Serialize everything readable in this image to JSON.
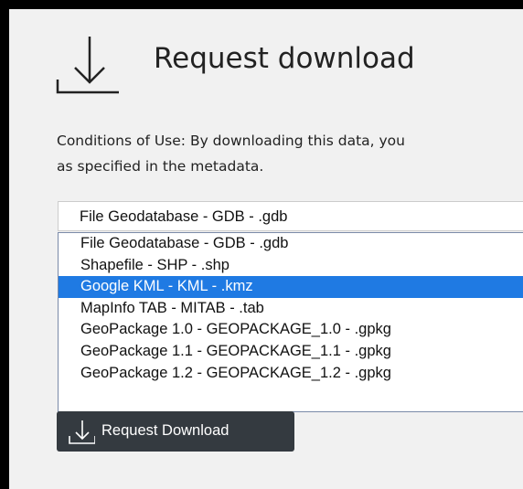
{
  "header": {
    "title": "Request download",
    "icon": "download-icon"
  },
  "conditions": {
    "text": "Conditions of Use: By downloading this data, you\nas specified in the metadata."
  },
  "format_select": {
    "selected": "File Geodatabase - GDB - .gdb",
    "options": [
      {
        "label": "File Geodatabase - GDB - .gdb",
        "highlighted": false
      },
      {
        "label": "Shapefile - SHP - .shp",
        "highlighted": false
      },
      {
        "label": "Google KML - KML - .kmz",
        "highlighted": true
      },
      {
        "label": "MapInfo TAB - MITAB - .tab",
        "highlighted": false
      },
      {
        "label": "GeoPackage 1.0 - GEOPACKAGE_1.0 - .gpkg",
        "highlighted": false
      },
      {
        "label": "GeoPackage 1.1 - GEOPACKAGE_1.1 - .gpkg",
        "highlighted": false
      },
      {
        "label": "GeoPackage 1.2 - GEOPACKAGE_1.2 - .gpkg",
        "highlighted": false
      }
    ]
  },
  "download_button": {
    "label": "Request Download",
    "icon": "download-icon"
  },
  "colors": {
    "highlight": "#1f7ae3",
    "button_bg": "#343a40",
    "panel_bg": "#f1f1f1"
  }
}
